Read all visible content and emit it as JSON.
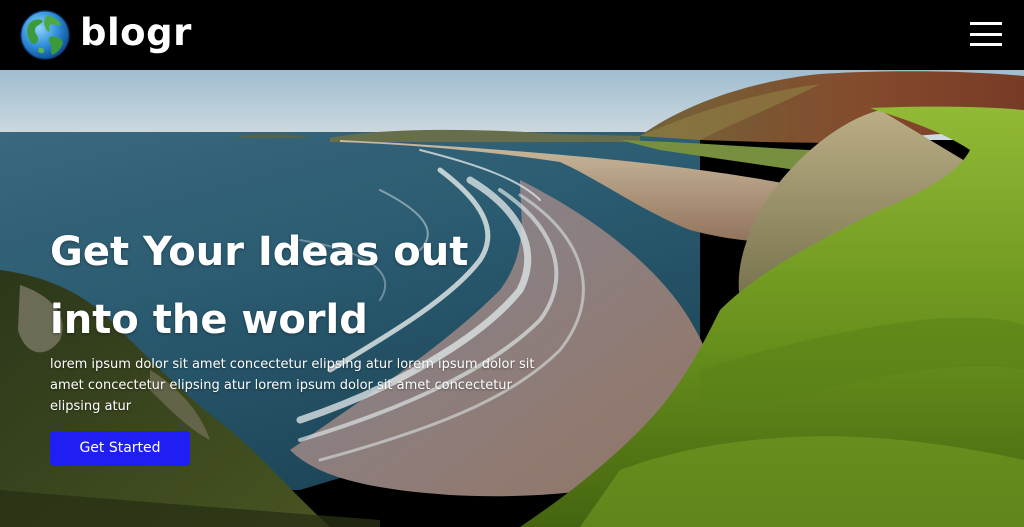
{
  "nav": {
    "brand": "blogr",
    "logo_icon": "globe-icon",
    "menu_icon": "hamburger-menu-icon"
  },
  "hero": {
    "title": "Get Your Ideas out into the world",
    "text": "lorem ipsum dolor sit amet concectetur elipsing atur lorem ipsum dolor sit amet concectetur elipsing atur lorem ipsum dolor sit amet concectetur elipsing atur",
    "cta_label": "Get Started",
    "background_image": "coastal-beach-cliffs-image"
  },
  "colors": {
    "navbar": "#000000",
    "text": "#ffffff",
    "cta": "#1f1ff4"
  }
}
